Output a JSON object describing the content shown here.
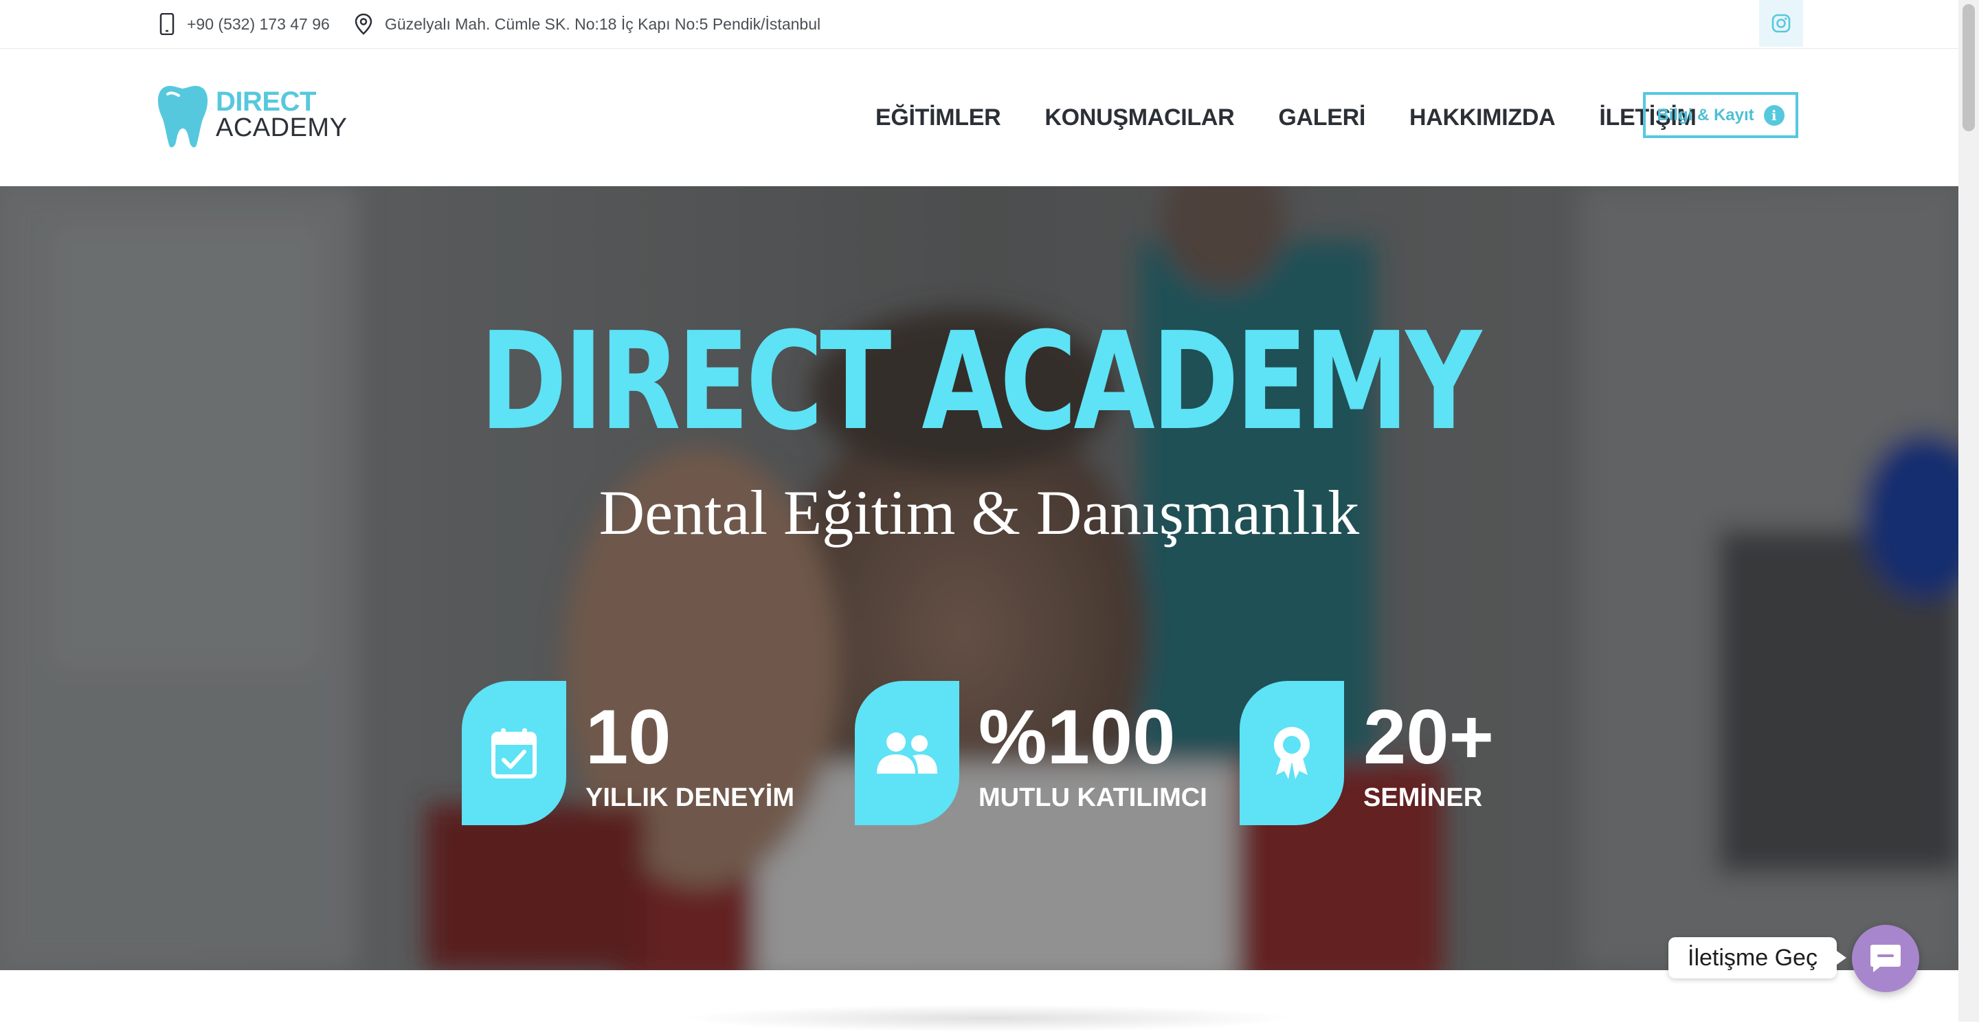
{
  "topbar": {
    "phone": "+90 (532) 173 47 96",
    "address": "Güzelyalı Mah. Cümle SK. No:18 İç Kapı No:5 Pendik/İstanbul",
    "social_icon": "instagram-icon"
  },
  "header": {
    "logo_line1": "DIRECT",
    "logo_line2": "ACADEMY",
    "nav": [
      {
        "label": "EĞİTİMLER"
      },
      {
        "label": "KONUŞMACILAR"
      },
      {
        "label": "GALERİ"
      },
      {
        "label": "HAKKIMIZDA"
      },
      {
        "label": "İLETİŞİM"
      }
    ],
    "cta_label": "Bilgi & Kayıt",
    "cta_icon": "info-icon"
  },
  "hero": {
    "title": "DIRECT ACADEMY",
    "subtitle": "Dental Eğitim & Danışmanlık",
    "stats": [
      {
        "value": "10",
        "label": "YILLIK DENEYİM",
        "icon": "calendar-check-icon"
      },
      {
        "value": "%100",
        "label": "MUTLU KATILIMCI",
        "icon": "users-icon"
      },
      {
        "value": "20+",
        "label": "SEMİNER",
        "icon": "award-icon"
      }
    ]
  },
  "chat": {
    "label": "İletişme Geç",
    "icon": "chat-icon"
  },
  "colors": {
    "accent": "#5ee2f5",
    "logo_blue": "#56c8de",
    "nav_text": "#2b2f36",
    "chat_purple": "#a886cd"
  }
}
